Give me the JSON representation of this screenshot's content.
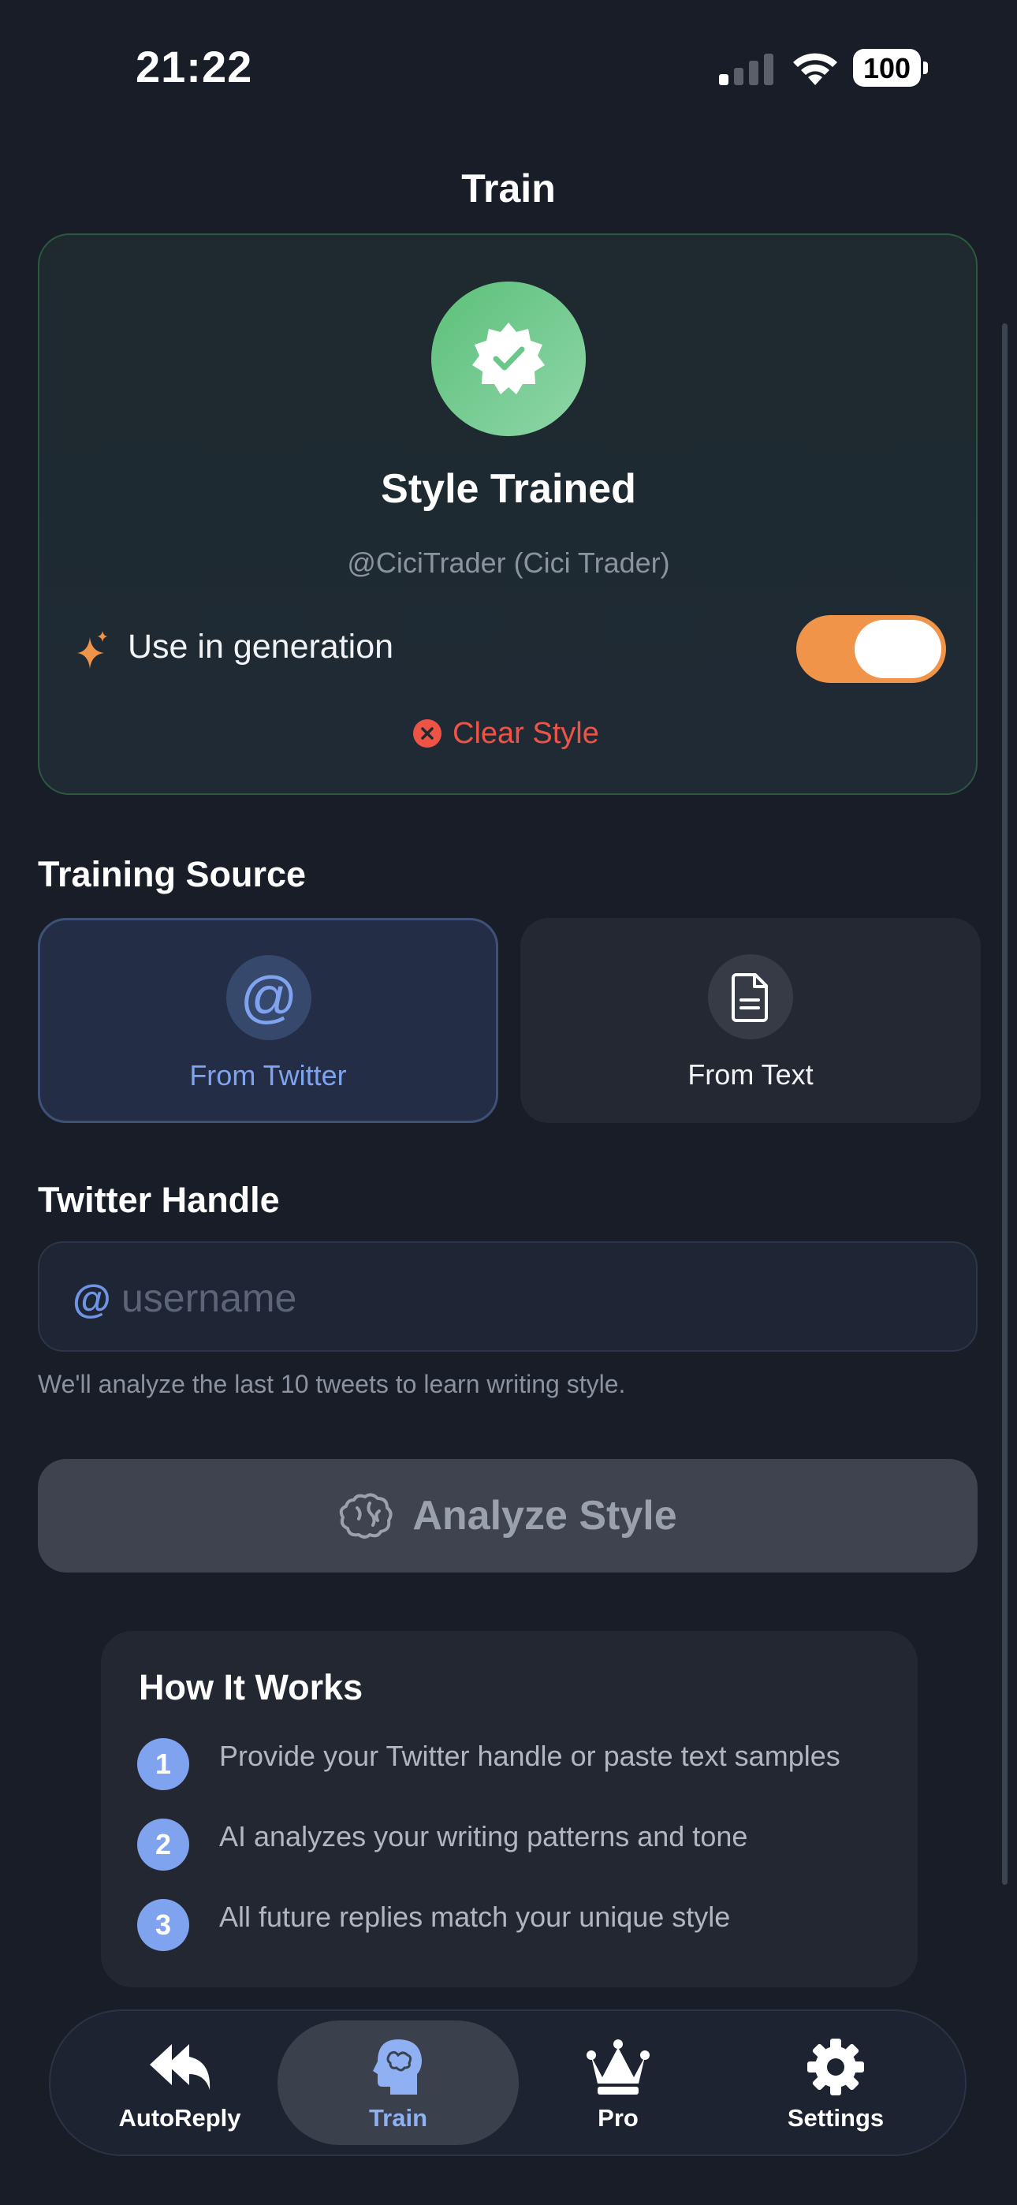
{
  "status_bar": {
    "time": "21:22",
    "battery": "100"
  },
  "header": {
    "title": "Train"
  },
  "trained_card": {
    "title": "Style Trained",
    "account": "@CiciTrader (Cici Trader)",
    "use_in_generation_label": "Use in generation",
    "use_in_generation_on": true,
    "clear_label": "Clear Style"
  },
  "training_source": {
    "title": "Training Source",
    "options": [
      {
        "label": "From Twitter",
        "icon": "at-icon",
        "selected": true
      },
      {
        "label": "From Text",
        "icon": "document-icon",
        "selected": false
      }
    ]
  },
  "twitter_handle": {
    "title": "Twitter Handle",
    "prefix": "@",
    "value": "",
    "placeholder": "username",
    "hint": "We'll analyze the last 10 tweets to learn writing style."
  },
  "analyze": {
    "label": "Analyze Style",
    "icon": "brain-icon",
    "enabled": false
  },
  "how_it_works": {
    "title": "How It Works",
    "steps": [
      {
        "num": "1",
        "text": "Provide your Twitter handle or paste text samples"
      },
      {
        "num": "2",
        "text": "AI analyzes your writing patterns and tone"
      },
      {
        "num": "3",
        "text": "All future replies match your unique style"
      }
    ]
  },
  "tabbar": {
    "items": [
      {
        "label": "AutoReply",
        "icon": "reply-all-icon"
      },
      {
        "label": "Train",
        "icon": "head-brain-icon",
        "active": true
      },
      {
        "label": "Pro",
        "icon": "crown-icon"
      },
      {
        "label": "Settings",
        "icon": "gear-icon"
      }
    ]
  },
  "colors": {
    "background": "#181d28",
    "accent_blue": "#7fa3ee",
    "toggle_orange": "#f0944a",
    "success_green": "#5cc07a",
    "danger_red": "#ee5446"
  }
}
